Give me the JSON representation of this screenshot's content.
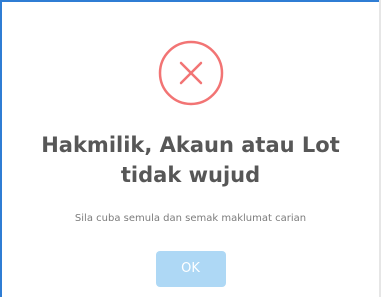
{
  "dialog": {
    "icon": "error-x-circle-icon",
    "icon_color": "#f27474",
    "title_line1": "Hakmilik, Akaun atau Lot",
    "title_line2": "tidak wujud",
    "message": "Sila cuba semula dan semak maklumat carian",
    "ok_label": "OK",
    "ok_color": "#aed8f5"
  }
}
